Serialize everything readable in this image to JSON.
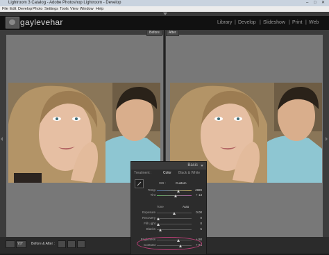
{
  "window": {
    "title": "Lightroom 3 Catalog - Adobe Photoshop Lightroom - Develop",
    "controls": [
      "–",
      "□",
      "✕"
    ]
  },
  "menu": [
    "File",
    "Edit",
    "Develop",
    "Photo",
    "Settings",
    "Tools",
    "View",
    "Window",
    "Help"
  ],
  "identity": {
    "logo_text": "gaylevehar"
  },
  "modules": [
    "Library",
    "Develop",
    "Slideshow",
    "Print",
    "Web"
  ],
  "active_module": "Develop",
  "view": {
    "before_label": "Before",
    "after_label": "After"
  },
  "panel": {
    "title": "Basic",
    "treatment_label": "Treatment :",
    "color_label": "Color",
    "bw_label": "Black & White",
    "wb_label": "WB :",
    "wb_value": "Custom",
    "sections": {
      "tone_label": "Tone",
      "auto_label": "Auto"
    },
    "sliders": [
      {
        "label": "Temp",
        "value": "4989",
        "level": 0.62
      },
      {
        "label": "Tint",
        "value": "+ 13",
        "level": 0.55
      },
      {
        "label": "Exposure",
        "value": "0.00",
        "level": 0.5
      },
      {
        "label": "Recovery",
        "value": "0",
        "level": 0.05
      },
      {
        "label": "Fill Light",
        "value": "0",
        "level": 0.05
      },
      {
        "label": "Blacks",
        "value": "5",
        "level": 0.1
      },
      {
        "label": "Brightness",
        "value": "+ 50",
        "level": 0.62
      },
      {
        "label": "Contrast",
        "value": "+ 64",
        "level": 0.68
      }
    ]
  },
  "toolbar": {
    "before_after_label": "Before & After :",
    "yy_label": "Y|Y"
  }
}
